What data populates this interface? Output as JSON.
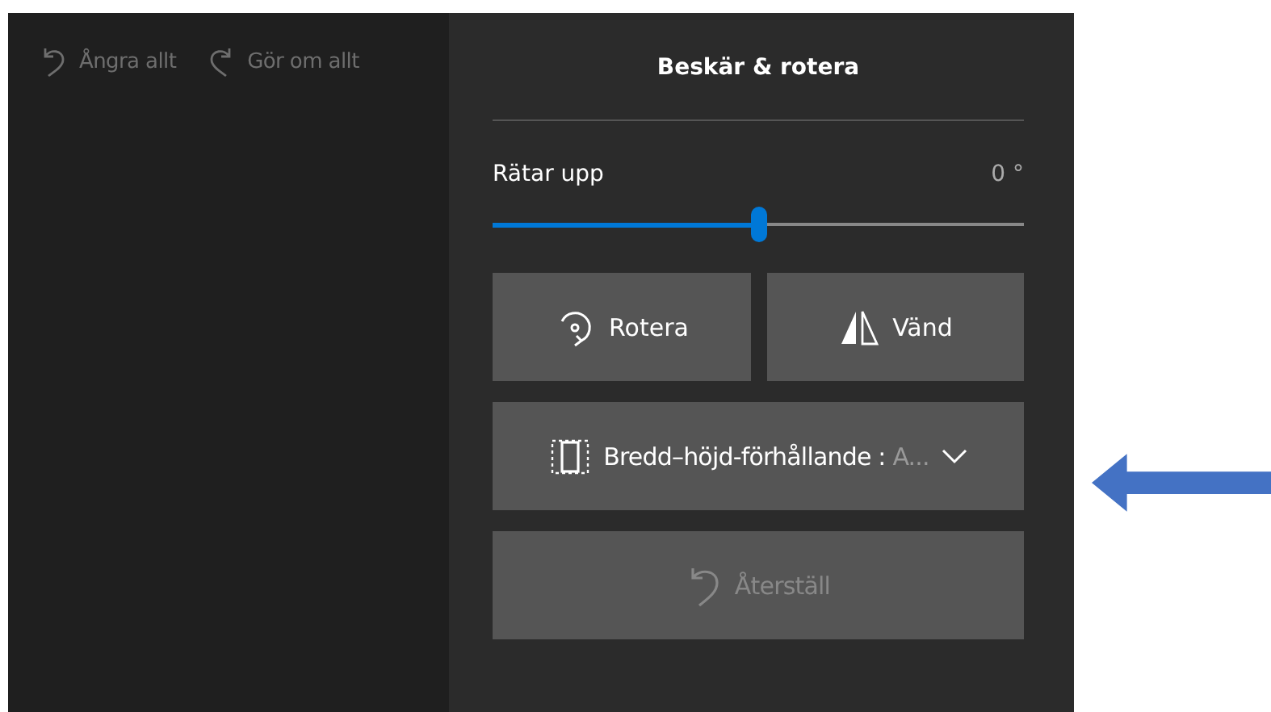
{
  "toolbar": [
    {
      "kind": "undo",
      "label": "Ångra allt",
      "disabled": true
    },
    {
      "kind": "redo",
      "label": "Gör om allt",
      "disabled": true
    }
  ],
  "panel": {
    "title": "Beskär & rotera",
    "straighten": {
      "label": "Rätar upp",
      "reading": "0 °",
      "level": 0.5
    },
    "buttons": [
      {
        "kind": "rotate",
        "label": "Rotera",
        "disabled": false
      },
      {
        "kind": "flip",
        "label": "Vänd",
        "disabled": false
      }
    ],
    "aspect_ratio": {
      "label": "Bredd–höjd-förhållande :",
      "value": "A..."
    },
    "reset": {
      "label": "Återställ",
      "disabled": true
    }
  },
  "annotation_arrow": true
}
